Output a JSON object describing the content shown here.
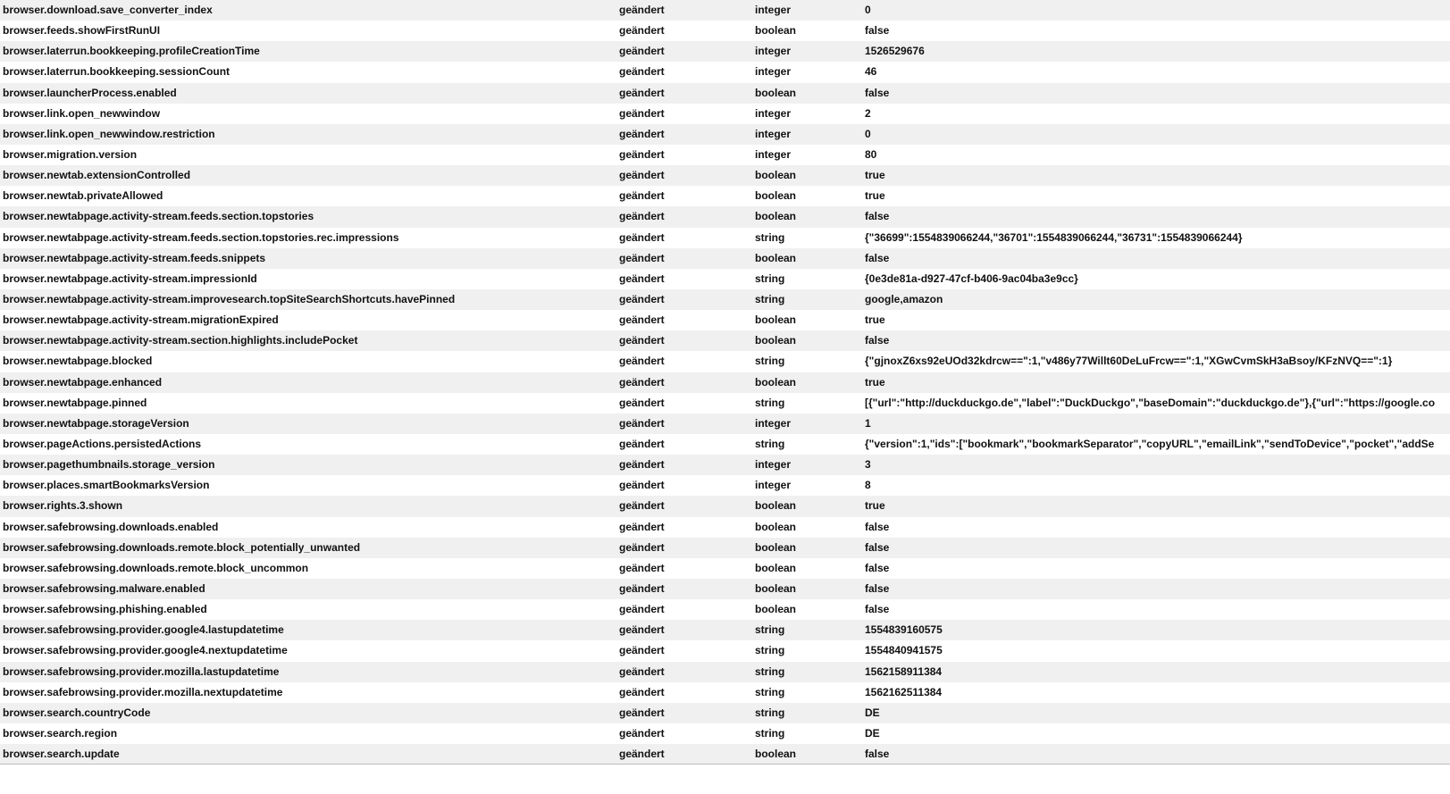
{
  "rows": [
    {
      "name": "browser.download.save_converter_index",
      "status": "geändert",
      "type": "integer",
      "value": "0"
    },
    {
      "name": "browser.feeds.showFirstRunUI",
      "status": "geändert",
      "type": "boolean",
      "value": "false"
    },
    {
      "name": "browser.laterrun.bookkeeping.profileCreationTime",
      "status": "geändert",
      "type": "integer",
      "value": "1526529676"
    },
    {
      "name": "browser.laterrun.bookkeeping.sessionCount",
      "status": "geändert",
      "type": "integer",
      "value": "46"
    },
    {
      "name": "browser.launcherProcess.enabled",
      "status": "geändert",
      "type": "boolean",
      "value": "false"
    },
    {
      "name": "browser.link.open_newwindow",
      "status": "geändert",
      "type": "integer",
      "value": "2"
    },
    {
      "name": "browser.link.open_newwindow.restriction",
      "status": "geändert",
      "type": "integer",
      "value": "0"
    },
    {
      "name": "browser.migration.version",
      "status": "geändert",
      "type": "integer",
      "value": "80"
    },
    {
      "name": "browser.newtab.extensionControlled",
      "status": "geändert",
      "type": "boolean",
      "value": "true"
    },
    {
      "name": "browser.newtab.privateAllowed",
      "status": "geändert",
      "type": "boolean",
      "value": "true"
    },
    {
      "name": "browser.newtabpage.activity-stream.feeds.section.topstories",
      "status": "geändert",
      "type": "boolean",
      "value": "false"
    },
    {
      "name": "browser.newtabpage.activity-stream.feeds.section.topstories.rec.impressions",
      "status": "geändert",
      "type": "string",
      "value": "{\"36699\":1554839066244,\"36701\":1554839066244,\"36731\":1554839066244}"
    },
    {
      "name": "browser.newtabpage.activity-stream.feeds.snippets",
      "status": "geändert",
      "type": "boolean",
      "value": "false"
    },
    {
      "name": "browser.newtabpage.activity-stream.impressionId",
      "status": "geändert",
      "type": "string",
      "value": "{0e3de81a-d927-47cf-b406-9ac04ba3e9cc}"
    },
    {
      "name": "browser.newtabpage.activity-stream.improvesearch.topSiteSearchShortcuts.havePinned",
      "status": "geändert",
      "type": "string",
      "value": "google,amazon"
    },
    {
      "name": "browser.newtabpage.activity-stream.migrationExpired",
      "status": "geändert",
      "type": "boolean",
      "value": "true"
    },
    {
      "name": "browser.newtabpage.activity-stream.section.highlights.includePocket",
      "status": "geändert",
      "type": "boolean",
      "value": "false"
    },
    {
      "name": "browser.newtabpage.blocked",
      "status": "geändert",
      "type": "string",
      "value": "{\"gjnoxZ6xs92eUOd32kdrcw==\":1,\"v486y77Willt60DeLuFrcw==\":1,\"XGwCvmSkH3aBsoy/KFzNVQ==\":1}"
    },
    {
      "name": "browser.newtabpage.enhanced",
      "status": "geändert",
      "type": "boolean",
      "value": "true"
    },
    {
      "name": "browser.newtabpage.pinned",
      "status": "geändert",
      "type": "string",
      "value": "[{\"url\":\"http://duckduckgo.de\",\"label\":\"DuckDuckgo\",\"baseDomain\":\"duckduckgo.de\"},{\"url\":\"https://google.co"
    },
    {
      "name": "browser.newtabpage.storageVersion",
      "status": "geändert",
      "type": "integer",
      "value": "1"
    },
    {
      "name": "browser.pageActions.persistedActions",
      "status": "geändert",
      "type": "string",
      "value": "{\"version\":1,\"ids\":[\"bookmark\",\"bookmarkSeparator\",\"copyURL\",\"emailLink\",\"sendToDevice\",\"pocket\",\"addSe"
    },
    {
      "name": "browser.pagethumbnails.storage_version",
      "status": "geändert",
      "type": "integer",
      "value": "3"
    },
    {
      "name": "browser.places.smartBookmarksVersion",
      "status": "geändert",
      "type": "integer",
      "value": "8"
    },
    {
      "name": "browser.rights.3.shown",
      "status": "geändert",
      "type": "boolean",
      "value": "true"
    },
    {
      "name": "browser.safebrowsing.downloads.enabled",
      "status": "geändert",
      "type": "boolean",
      "value": "false"
    },
    {
      "name": "browser.safebrowsing.downloads.remote.block_potentially_unwanted",
      "status": "geändert",
      "type": "boolean",
      "value": "false"
    },
    {
      "name": "browser.safebrowsing.downloads.remote.block_uncommon",
      "status": "geändert",
      "type": "boolean",
      "value": "false"
    },
    {
      "name": "browser.safebrowsing.malware.enabled",
      "status": "geändert",
      "type": "boolean",
      "value": "false"
    },
    {
      "name": "browser.safebrowsing.phishing.enabled",
      "status": "geändert",
      "type": "boolean",
      "value": "false"
    },
    {
      "name": "browser.safebrowsing.provider.google4.lastupdatetime",
      "status": "geändert",
      "type": "string",
      "value": "1554839160575"
    },
    {
      "name": "browser.safebrowsing.provider.google4.nextupdatetime",
      "status": "geändert",
      "type": "string",
      "value": "1554840941575"
    },
    {
      "name": "browser.safebrowsing.provider.mozilla.lastupdatetime",
      "status": "geändert",
      "type": "string",
      "value": "1562158911384"
    },
    {
      "name": "browser.safebrowsing.provider.mozilla.nextupdatetime",
      "status": "geändert",
      "type": "string",
      "value": "1562162511384"
    },
    {
      "name": "browser.search.countryCode",
      "status": "geändert",
      "type": "string",
      "value": "DE"
    },
    {
      "name": "browser.search.region",
      "status": "geändert",
      "type": "string",
      "value": "DE"
    },
    {
      "name": "browser.search.update",
      "status": "geändert",
      "type": "boolean",
      "value": "false"
    }
  ]
}
